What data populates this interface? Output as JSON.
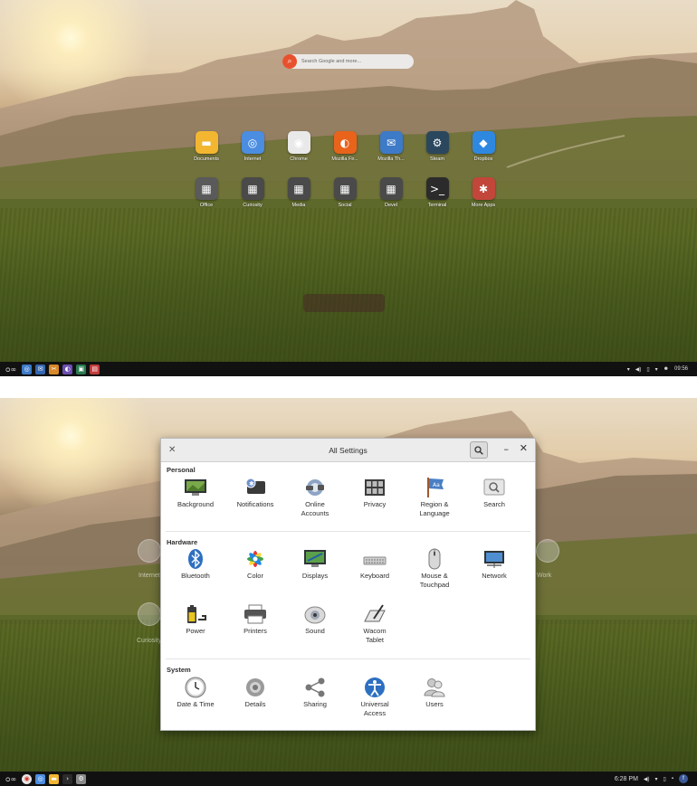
{
  "screen1": {
    "search": {
      "placeholder": "Search Google and more..."
    },
    "launcher_row1": [
      {
        "label": "Documents",
        "icon": "folder-icon",
        "color": "#f2b631",
        "glyph": "▬"
      },
      {
        "label": "Internet",
        "icon": "internet-icon",
        "color": "#4b8de0",
        "glyph": "◎"
      },
      {
        "label": "Chrome",
        "icon": "chrome-icon",
        "color": "#e9e9e9",
        "glyph": "◉"
      },
      {
        "label": "Mozilla Fir...",
        "icon": "firefox-icon",
        "color": "#e9631b",
        "glyph": "◐"
      },
      {
        "label": "Mozilla Th...",
        "icon": "thunderbird-icon",
        "color": "#3d7ac7",
        "glyph": "✉"
      },
      {
        "label": "Steam",
        "icon": "steam-icon",
        "color": "#2a475e",
        "glyph": "⚙"
      },
      {
        "label": "Dropbox",
        "icon": "dropbox-icon",
        "color": "#2f88e0",
        "glyph": "◆"
      }
    ],
    "launcher_row2": [
      {
        "label": "Office",
        "icon": "office-folder-icon",
        "color": "#5a5a5a",
        "glyph": "▦"
      },
      {
        "label": "Curiosity",
        "icon": "curiosity-folder-icon",
        "color": "#4a4a4a",
        "glyph": "▦"
      },
      {
        "label": "Media",
        "icon": "media-folder-icon",
        "color": "#4a4a4a",
        "glyph": "▦"
      },
      {
        "label": "Social",
        "icon": "social-folder-icon",
        "color": "#4a4a4a",
        "glyph": "▦"
      },
      {
        "label": "Devel",
        "icon": "devel-folder-icon",
        "color": "#4a4a4a",
        "glyph": "▦"
      },
      {
        "label": "Terminal",
        "icon": "terminal-icon",
        "color": "#2b2b2b",
        "glyph": ">_"
      },
      {
        "label": "More Apps",
        "icon": "more-apps-icon",
        "color": "#c2463a",
        "glyph": "✱"
      }
    ],
    "taskbar": {
      "logo": "ᴑ∞",
      "time": "09:56"
    }
  },
  "screen2": {
    "window": {
      "title": "All Settings"
    },
    "ghost_labels": [
      "Internet",
      "Curiosity",
      "Work"
    ],
    "sections": [
      {
        "title": "Personal",
        "items": [
          {
            "label": "Background",
            "icon": "background-icon"
          },
          {
            "label": "Notifications",
            "icon": "notifications-icon"
          },
          {
            "label": "Online\nAccounts",
            "icon": "online-accounts-icon"
          },
          {
            "label": "Privacy",
            "icon": "privacy-icon"
          },
          {
            "label": "Region &\nLanguage",
            "icon": "region-language-icon"
          },
          {
            "label": "Search",
            "icon": "search-settings-icon"
          }
        ]
      },
      {
        "title": "Hardware",
        "items": [
          {
            "label": "Bluetooth",
            "icon": "bluetooth-icon"
          },
          {
            "label": "Color",
            "icon": "color-icon"
          },
          {
            "label": "Displays",
            "icon": "displays-icon"
          },
          {
            "label": "Keyboard",
            "icon": "keyboard-icon"
          },
          {
            "label": "Mouse &\nTouchpad",
            "icon": "mouse-touchpad-icon"
          },
          {
            "label": "Network",
            "icon": "network-icon"
          },
          {
            "label": "Power",
            "icon": "power-icon"
          },
          {
            "label": "Printers",
            "icon": "printers-icon"
          },
          {
            "label": "Sound",
            "icon": "sound-icon"
          },
          {
            "label": "Wacom\nTablet",
            "icon": "wacom-tablet-icon"
          }
        ]
      },
      {
        "title": "System",
        "items": [
          {
            "label": "Date & Time",
            "icon": "date-time-icon"
          },
          {
            "label": "Details",
            "icon": "details-icon"
          },
          {
            "label": "Sharing",
            "icon": "sharing-icon"
          },
          {
            "label": "Universal\nAccess",
            "icon": "universal-access-icon"
          },
          {
            "label": "Users",
            "icon": "users-icon"
          }
        ]
      }
    ],
    "taskbar": {
      "logo": "ᴑ∞",
      "time": "6:28 PM"
    }
  }
}
